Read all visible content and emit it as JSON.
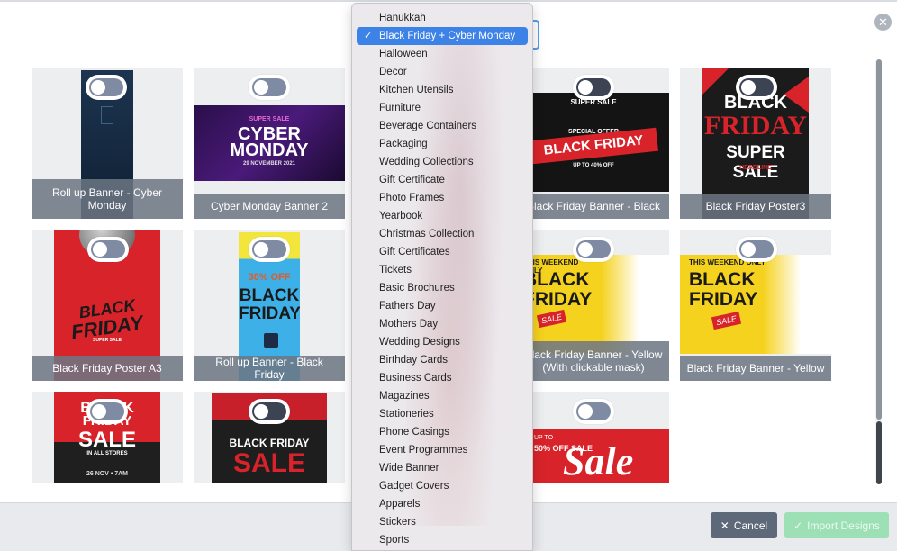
{
  "dialog": {
    "close_glyph": "✕"
  },
  "cards": [
    {
      "label": "Roll up Banner - Cyber Monday",
      "toggle_on": false
    },
    {
      "label": "Cyber Monday Banner 2",
      "toggle_on": false,
      "art_small": "SUPER SALE",
      "art_big1": "CYBER",
      "art_big2": "MONDAY",
      "art_date": "29 NOVEMBER 2021"
    },
    {
      "label": "Black Friday Banner - Black",
      "toggle_on": false,
      "art_small": "SUPER SALE",
      "art_offer": "SPECIAL OFFER",
      "art_big": "BLACK FRIDAY",
      "art_upto": "UP TO 40% OFF"
    },
    {
      "label": "Black Friday Poster3",
      "toggle_on": false,
      "art_big1": "BLACK",
      "art_big2": "FRIDAY",
      "art_big3": "SUPER SALE",
      "art_head": "HEADLINE"
    },
    {
      "label": "Black Friday Poster A3",
      "toggle_on": false,
      "art_big1": "BLACK",
      "art_big2": "FRIDAY",
      "art_small": "SUPER SALE"
    },
    {
      "label": "Roll up Banner - Black Friday",
      "toggle_on": false,
      "art_pct": "30% OFF",
      "art_big1": "BLACK",
      "art_big2": "FRIDAY"
    },
    {
      "label": "Black Friday Banner - Yellow (With clickable mask)",
      "toggle_on": false,
      "art_top": "THIS WEEKEND ONLY",
      "art_big1": "BLACK",
      "art_big2": "FRIDAY",
      "art_tag": "SALE"
    },
    {
      "label": "Black Friday Banner - Yellow",
      "toggle_on": false,
      "art_top": "THIS WEEKEND ONLY",
      "art_big1": "BLACK",
      "art_big2": "FRIDAY",
      "art_tag": "SALE"
    },
    {
      "label": "",
      "toggle_on": false,
      "art_big1": "BLACK",
      "art_big2": "FRIDAY",
      "art_big3": "SALE",
      "art_small": "IN ALL STORES",
      "art_date": "26 NOV • 7AM"
    },
    {
      "label": "",
      "toggle_on": false,
      "art_big1": "BLACK FRIDAY",
      "art_big2": "SALE"
    },
    {
      "label": "",
      "toggle_on": false,
      "art_small": "UP TO",
      "art_pct": "50% OFF SALE",
      "art_big": "Sale"
    }
  ],
  "dropdown": {
    "selected_index": 1,
    "check_glyph": "✓",
    "options": [
      "Hanukkah",
      "Black Friday + Cyber Monday",
      "Halloween",
      "Decor",
      "Kitchen Utensils",
      "Furniture",
      "Beverage Containers",
      "Packaging",
      "Wedding Collections",
      "Gift Certificate",
      "Photo Frames",
      "Yearbook",
      "Christmas Collection",
      "Gift Certificates",
      "Tickets",
      "Basic Brochures",
      "Fathers Day",
      "Mothers Day",
      "Wedding Designs",
      "Birthday Cards",
      "Business Cards",
      "Magazines",
      "Stationeries",
      "Phone Casings",
      "Event Programmes",
      "Wide Banner",
      "Gadget Covers",
      "Apparels",
      "Stickers",
      "Sports"
    ]
  },
  "footer": {
    "cancel_icon": "✕",
    "cancel_label": "Cancel",
    "import_icon": "✓",
    "import_label": "Import Designs"
  },
  "colors": {
    "accent_blue": "#3d82e6",
    "cancel_bg": "#5d6878",
    "import_bg": "#9ee0b6",
    "label_bg": "#6c7684"
  }
}
